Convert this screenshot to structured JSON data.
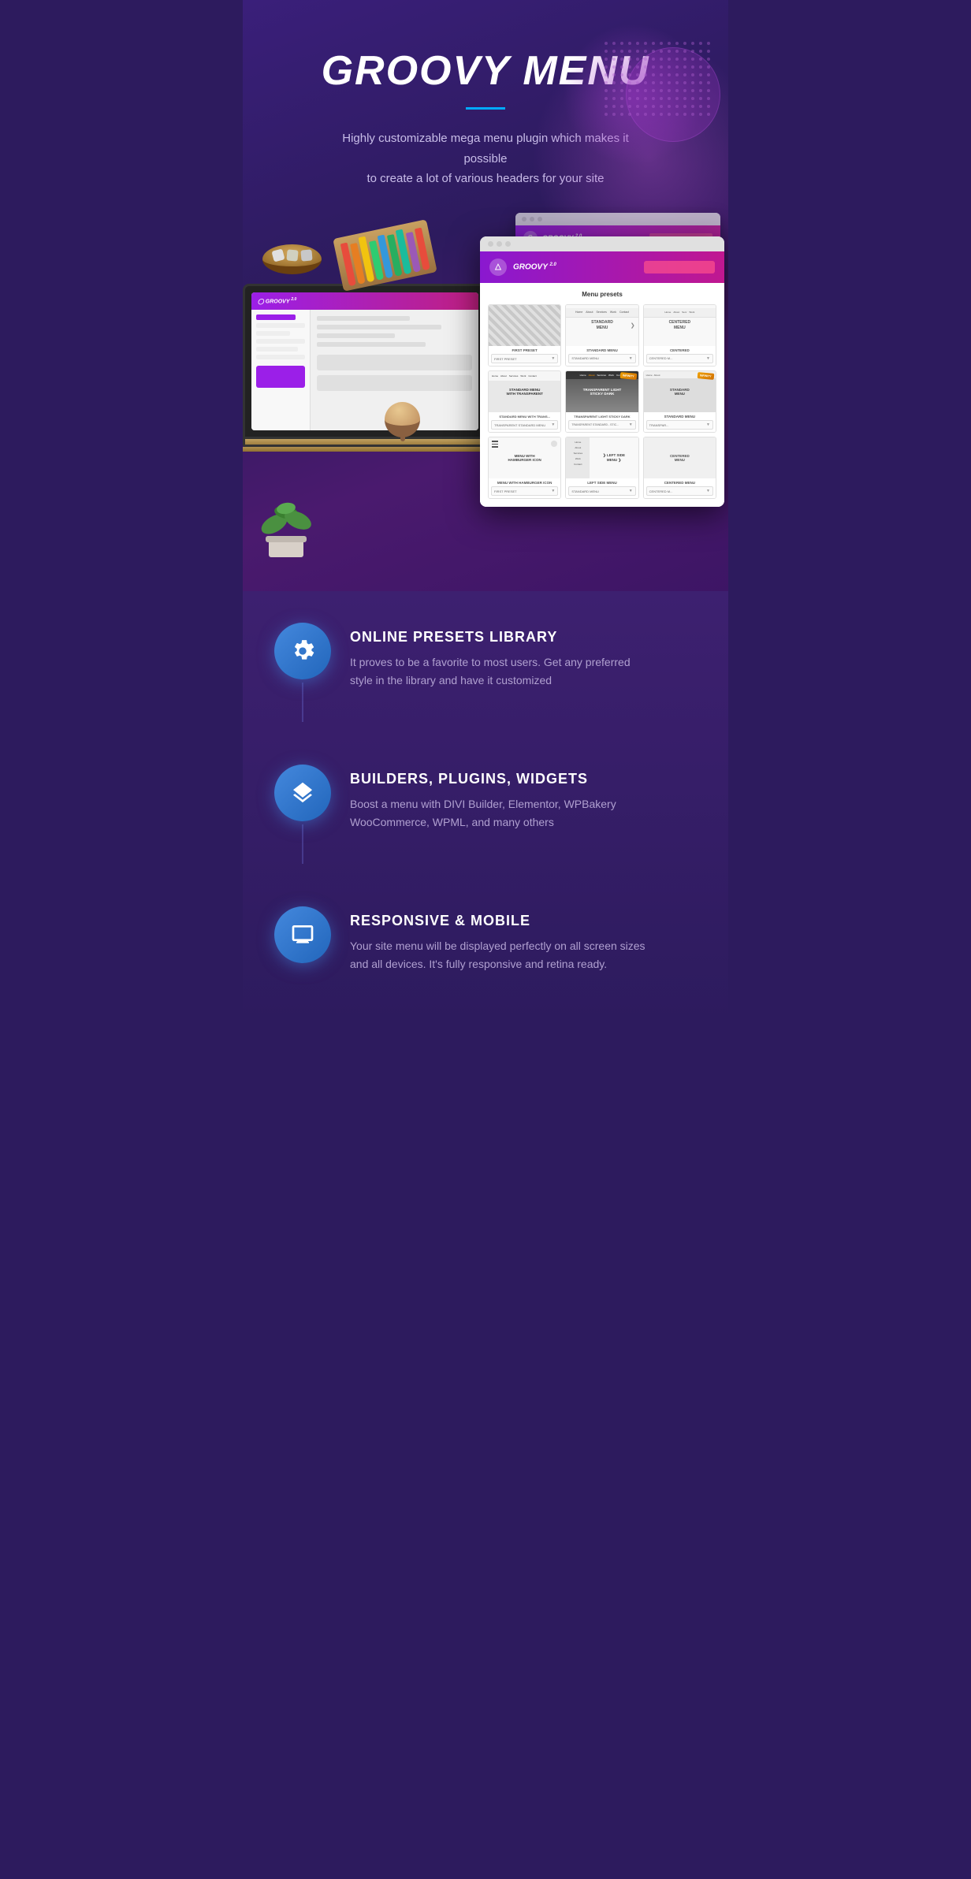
{
  "hero": {
    "title": "GROOVY MENU",
    "subtitle_line1": "Highly customizable mega menu plugin which makes it possible",
    "subtitle_line2": "to create a lot of various headers for your site"
  },
  "browser_card": {
    "presets_label": "Menu presets",
    "logo": "GROOVY",
    "version": "2.0",
    "presets": [
      {
        "name": "FIRST PRESET",
        "type": "image",
        "dropdown": "FIRST PRESET"
      },
      {
        "name": "STANDARD MENU",
        "type": "nav",
        "dropdown": "STANDARD MENU"
      },
      {
        "name": "CENTERED MENU",
        "type": "nav",
        "dropdown": "CENTERED M..."
      },
      {
        "name": "STANDARD MENU WITH TRANSPARENT",
        "type": "nav",
        "dropdown": "TRANSPARENT STANDARD MENU"
      },
      {
        "name": "TRANSPARENT LIGHT STICKY DARK",
        "type": "nav",
        "badge": "INFINITY",
        "dropdown": "TRANSPARENT STANDARD - STIC..."
      },
      {
        "name": "STANDARD MENU",
        "type": "nav",
        "badge": "INFINITY",
        "dropdown": "TRANSPAR..."
      },
      {
        "name": "MENU WITH HAMBURGER ICON",
        "type": "hamburger",
        "dropdown": "FIRST PRESET"
      },
      {
        "name": "LEFT SIDE MENU",
        "type": "sidebar",
        "dropdown": "STANDARD MENU"
      },
      {
        "name": "CENTERED MENU",
        "type": "centered",
        "dropdown": "CENTERED M..."
      }
    ]
  },
  "features": [
    {
      "id": "online-presets",
      "icon": "wrench",
      "title": "ONLINE PRESETS LIBRARY",
      "description": "It proves to be a favorite to most users. Get any preferred  style in the library and have it customized"
    },
    {
      "id": "builders",
      "icon": "layers",
      "title": "BUILDERS, PLUGINS, WIDGETS",
      "description": "Boost a menu with DIVI Builder, Elementor, WPBakery WooCommerce, WPML, and many others"
    },
    {
      "id": "responsive",
      "icon": "monitor",
      "title": "RESPONSIVE & MOBILE",
      "description": "Your site menu will be displayed perfectly on all screen sizes and all devices. It's fully responsive and retina ready."
    }
  ],
  "colors": {
    "accent_blue": "#00aaff",
    "purple_dark": "#2d1b5e",
    "purple_mid": "#9b1fe8",
    "icon_blue": "#4488dd",
    "text_muted": "#b0a0d0"
  },
  "crayons": [
    "#e74c3c",
    "#e67e22",
    "#f1c40f",
    "#2ecc71",
    "#27ae60",
    "#1abc9c",
    "#3498db",
    "#2980b9",
    "#9b59b6"
  ]
}
